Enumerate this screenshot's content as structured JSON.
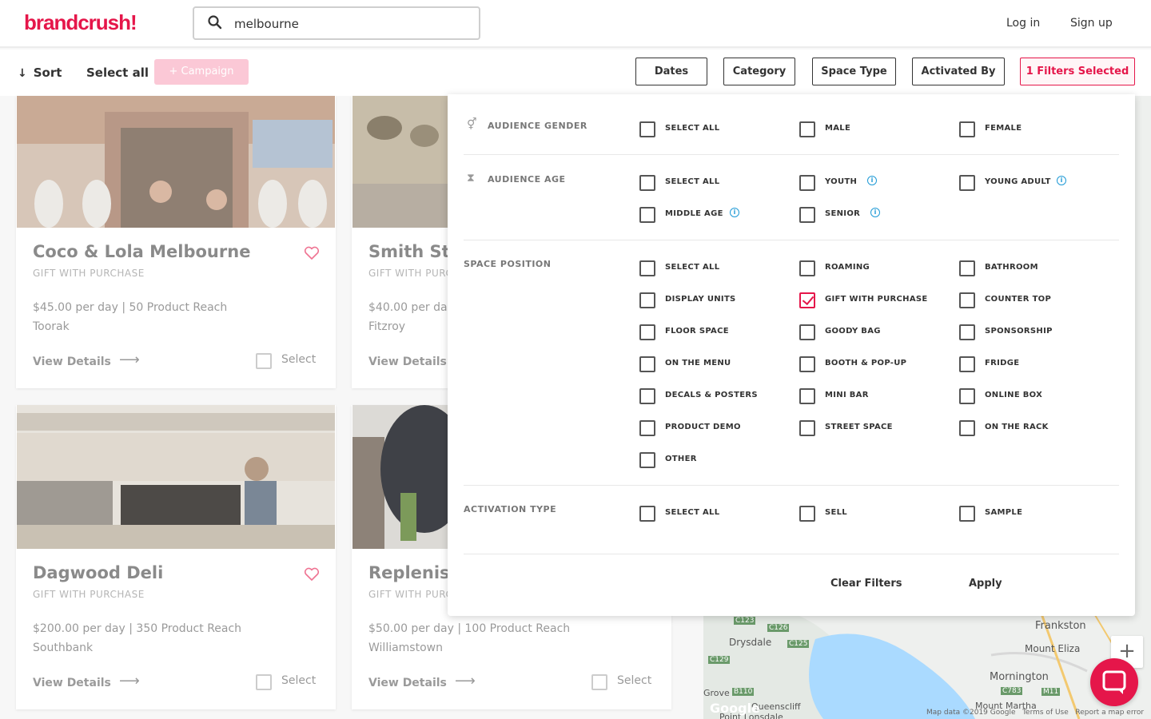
{
  "header": {
    "logo": "brandcrush!",
    "search_value": "melbourne",
    "login": "Log in",
    "signup": "Sign up"
  },
  "toolbar": {
    "sort": "Sort",
    "select_all": "Select all",
    "campaign": "+ Campaign",
    "filters": [
      "Dates",
      "Category",
      "Space Type",
      "Activated By",
      "1 Filters Selected"
    ]
  },
  "cards": [
    {
      "title": "Coco & Lola Melbourne",
      "sub": "GIFT WITH PURCHASE",
      "price": "$45.00 per day | 50 Product Reach",
      "location": "Toorak",
      "details": "View Details",
      "select": "Select"
    },
    {
      "title": "Smith Str",
      "sub": "GIFT WITH PURC",
      "price": "$40.00 per da",
      "location": "Fitzroy",
      "details": "View Details",
      "select": ""
    },
    {
      "title": "Dagwood Deli",
      "sub": "GIFT WITH PURCHASE",
      "price": "$200.00 per day | 350 Product Reach",
      "location": "Southbank",
      "details": "View Details",
      "select": "Select"
    },
    {
      "title": "Replenish",
      "sub": "GIFT WITH PURC",
      "price": "$50.00 per day | 100 Product Reach",
      "location": "Williamstown",
      "details": "View Details",
      "select": "Select"
    }
  ],
  "panel": {
    "audience_gender": {
      "label": "AUDIENCE GENDER",
      "options": [
        "SELECT ALL",
        "MALE",
        "FEMALE"
      ]
    },
    "audience_age": {
      "label": "AUDIENCE AGE",
      "options": [
        "SELECT ALL",
        "YOUTH",
        "YOUNG ADULT",
        "MIDDLE AGE",
        "SENIOR"
      ]
    },
    "space_position": {
      "label": "SPACE POSITION",
      "options": [
        "SELECT ALL",
        "ROAMING",
        "BATHROOM",
        "DISPLAY UNITS",
        "GIFT WITH PURCHASE",
        "COUNTER TOP",
        "FLOOR SPACE",
        "GOODY BAG",
        "SPONSORSHIP",
        "ON THE MENU",
        "BOOTH & POP-UP",
        "FRIDGE",
        "DECALS & POSTERS",
        "MINI BAR",
        "ONLINE BOX",
        "PRODUCT DEMO",
        "STREET SPACE",
        "ON THE RACK",
        "OTHER"
      ],
      "checked": "GIFT WITH PURCHASE"
    },
    "activation_type": {
      "label": "ACTIVATION TYPE",
      "options": [
        "SELECT ALL",
        "SELL",
        "SAMPLE"
      ]
    },
    "clear": "Clear Filters",
    "apply": "Apply"
  },
  "map": {
    "labels": [
      "Frankston",
      "Drysdale",
      "Mount Eliza",
      "Mornington",
      "Mount Martha",
      "Grove",
      "Queenscliff",
      "Point Lonsdale",
      "C123",
      "C126",
      "C125",
      "C129",
      "B110",
      "C783",
      "M11"
    ],
    "footer": "Map data ©2019 Google   Terms of Use   Report a map error",
    "google": "Google"
  },
  "colors": {
    "brand": "#e5164a",
    "info": "#1f9ad6"
  }
}
